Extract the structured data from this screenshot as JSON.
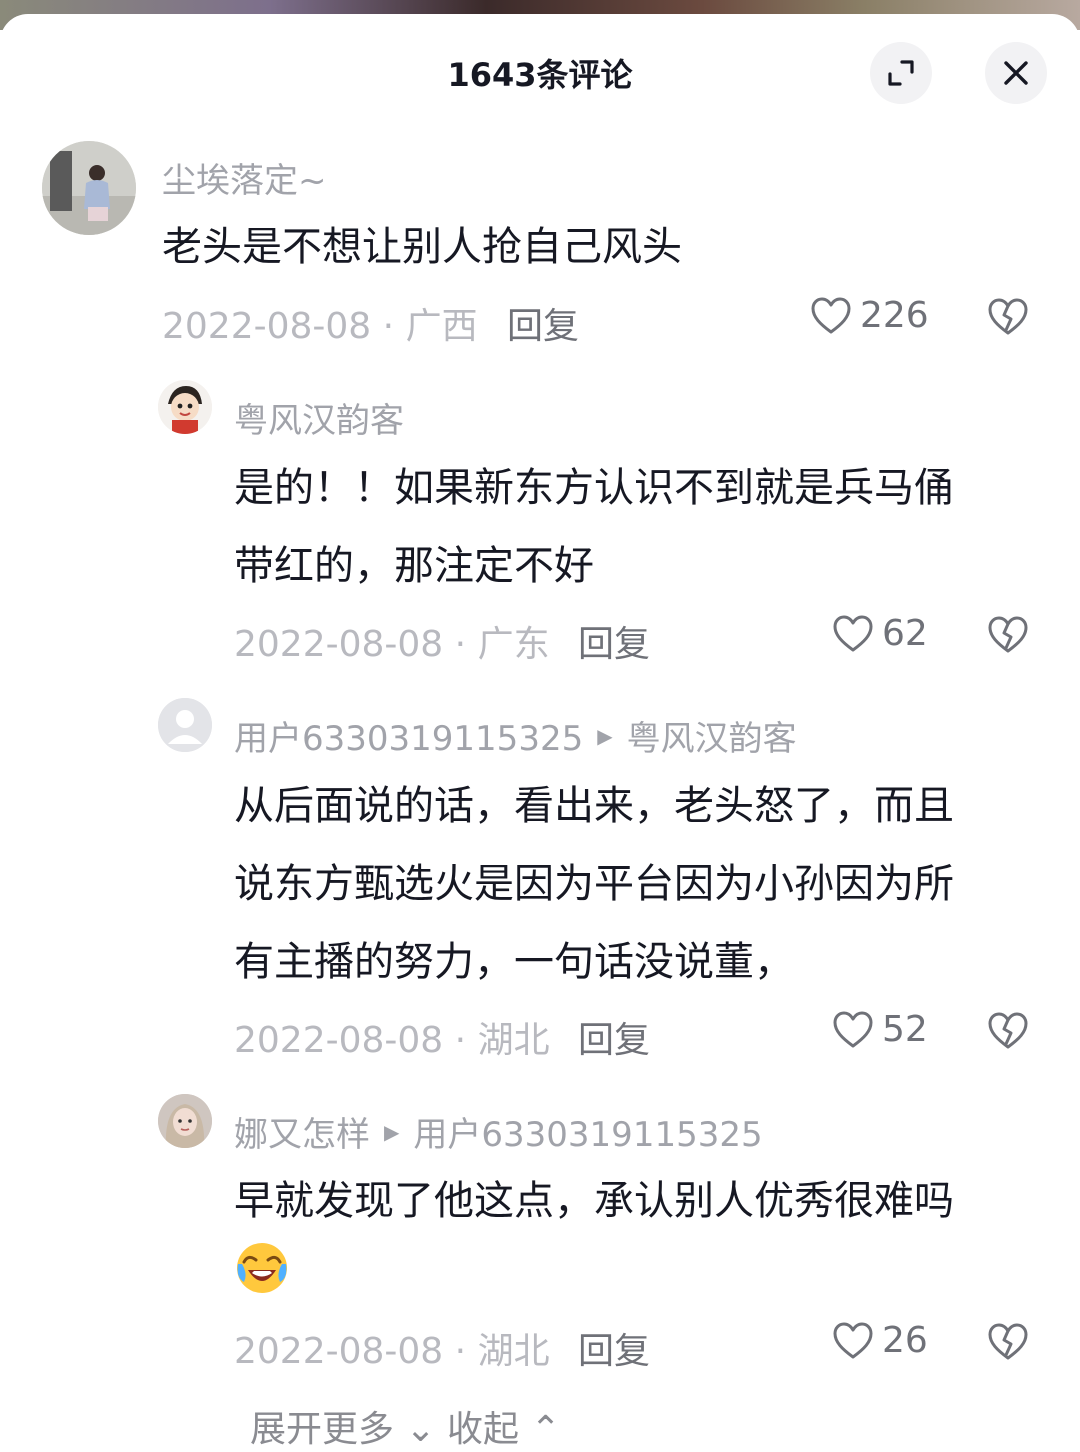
{
  "header": {
    "title": "1643条评论"
  },
  "comments": [
    {
      "username": "尘埃落定~",
      "text_lines": [
        "老头是不想让别人抢自己风头"
      ],
      "date": "2022-08-08",
      "location": "广西",
      "reply_label": "回复",
      "likes": "226"
    },
    {
      "username": "粤风汉韵客",
      "text_lines": [
        "是的！！如果新东方认识不到就是兵马俑",
        "带红的，那注定不好"
      ],
      "date": "2022-08-08",
      "location": "广东",
      "reply_label": "回复",
      "likes": "62"
    },
    {
      "username": "用户6330319115325",
      "reply_to": "粤风汉韵客",
      "text_lines": [
        "从后面说的话，看出来，老头怒了，而且",
        "说东方甄选火是因为平台因为小孙因为所",
        "有主播的努力，一句话没说董，"
      ],
      "date": "2022-08-08",
      "location": "湖北",
      "reply_label": "回复",
      "likes": "52"
    },
    {
      "username": "娜又怎样",
      "reply_to": "用户6330319115325",
      "text_lines": [
        "早就发现了他这点，承认别人优秀很难吗"
      ],
      "emoji": "laughing-crying",
      "date": "2022-08-08",
      "location": "湖北",
      "reply_label": "回复",
      "likes": "26"
    }
  ],
  "footer": {
    "more_label": "展开更多 ⌄   收起 ⌃"
  },
  "colors": {
    "accent_text": "#161823",
    "muted": "#a1a3aa",
    "button_bg": "#f2f2f4"
  }
}
